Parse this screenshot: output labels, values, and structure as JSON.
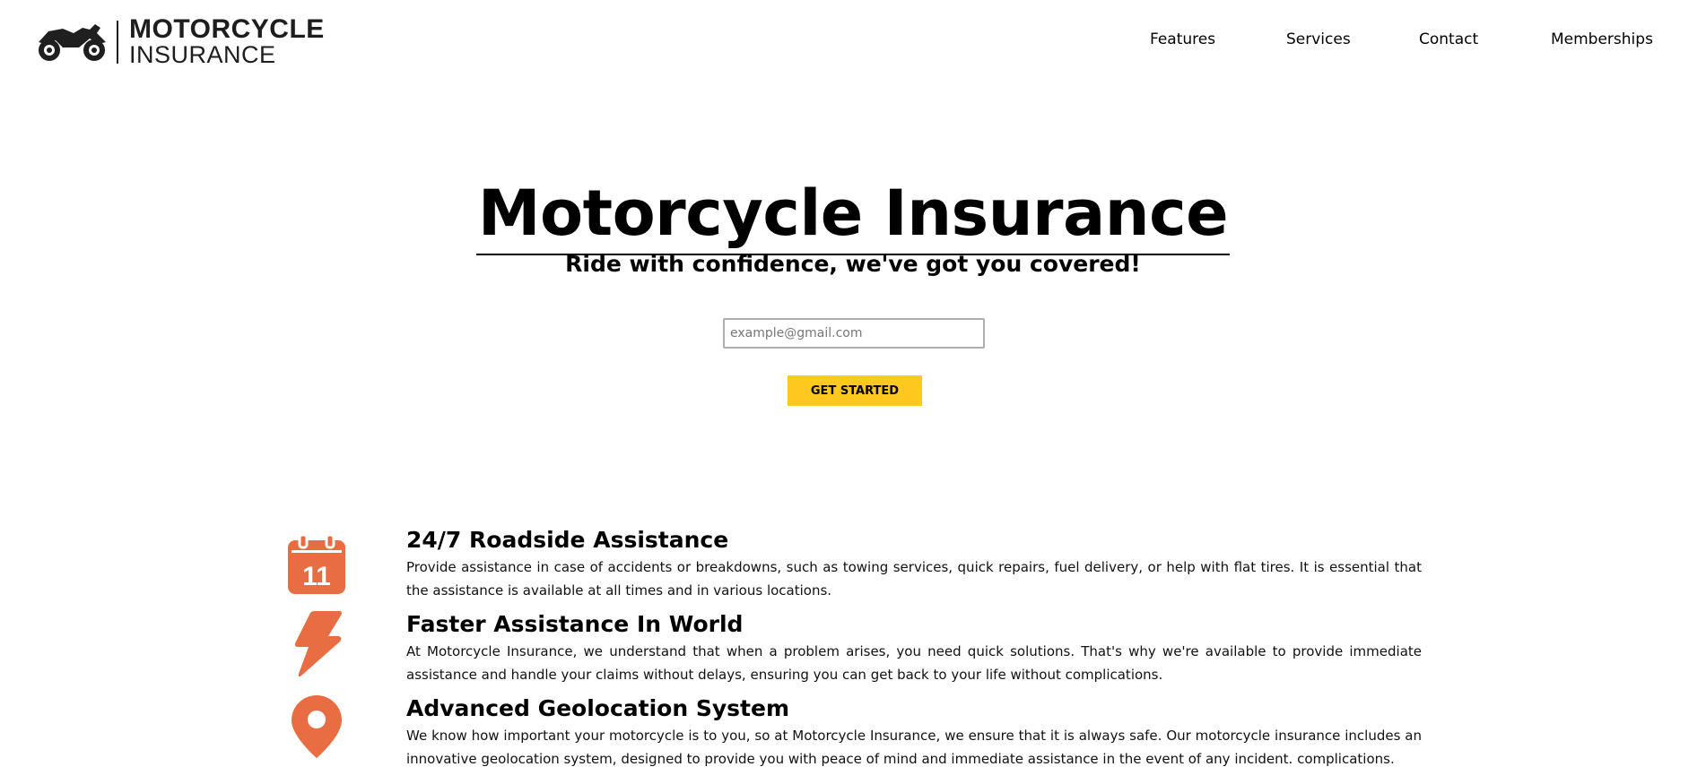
{
  "brand": {
    "line1": "MOTORCYCLE",
    "line2": "INSURANCE"
  },
  "nav": {
    "items": [
      "Features",
      "Services",
      "Contact",
      "Memberships"
    ]
  },
  "hero": {
    "title": "Motorcycle Insurance",
    "subtitle": "Ride with confidence, we've got you covered!",
    "email_placeholder": "example@gmail.com",
    "cta_label": "GET STARTED"
  },
  "features": [
    {
      "icon": "calendar-icon",
      "icon_text": "11",
      "title": "24/7 Roadside Assistance",
      "description": "Provide assistance in case of accidents or breakdowns, such as towing services, quick repairs, fuel delivery, or help with flat tires. It is essential that the assistance is available at all times and in various locations."
    },
    {
      "icon": "lightning-icon",
      "title": "Faster Assistance In World",
      "description": "At Motorcycle Insurance, we understand that when a problem arises, you need quick solutions. That's why we're available to provide immediate assistance and handle your claims without delays, ensuring you can get back to your life without complications."
    },
    {
      "icon": "location-pin-icon",
      "title": "Advanced Geolocation System",
      "description": "We know how important your motorcycle is to you, so at Motorcycle Insurance, we ensure that it is always safe. Our motorcycle insurance includes an innovative geolocation system, designed to provide you with peace of mind and immediate assistance in the event of any incident. complications."
    }
  ],
  "colors": {
    "accent": "#fdc91e",
    "icon": "#e86d42",
    "text": "#000000"
  }
}
